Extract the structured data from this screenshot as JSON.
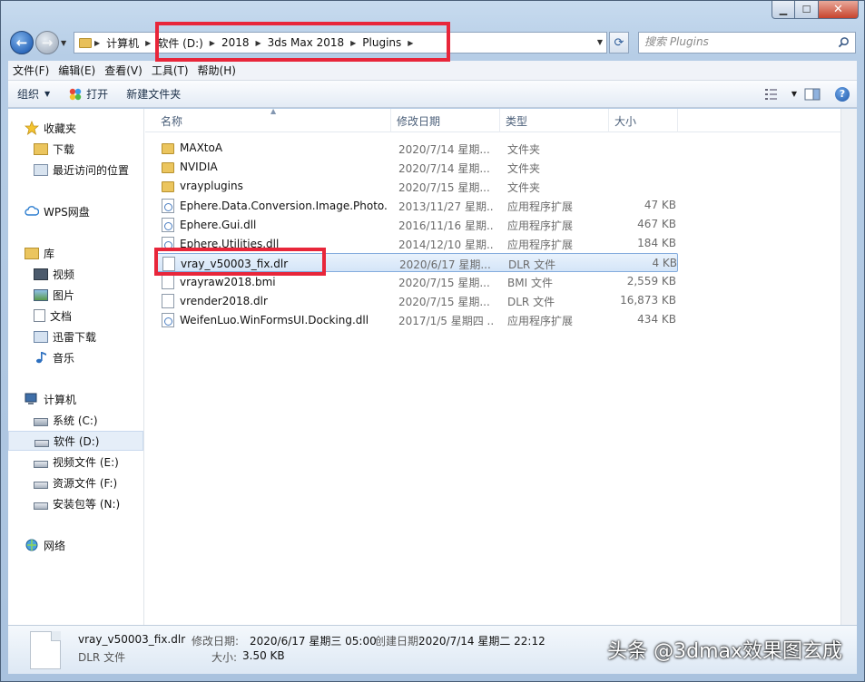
{
  "address": {
    "crumbs": [
      "计算机",
      "软件 (D:)",
      "2018",
      "3ds Max 2018",
      "Plugins"
    ]
  },
  "search": {
    "placeholder": "搜索 Plugins"
  },
  "menu": [
    "文件(F)",
    "编辑(E)",
    "查看(V)",
    "工具(T)",
    "帮助(H)"
  ],
  "toolbar": {
    "organize": "组织",
    "open": "打开",
    "new_folder": "新建文件夹"
  },
  "sidebar": {
    "favorites": "收藏夹",
    "downloads": "下载",
    "recent": "最近访问的位置",
    "wps": "WPS网盘",
    "library": "库",
    "videos": "视频",
    "pictures": "图片",
    "documents": "文档",
    "thunder": "迅雷下载",
    "music": "音乐",
    "computer": "计算机",
    "drive_c": "系统 (C:)",
    "drive_d": "软件 (D:)",
    "drive_e": "视频文件 (E:)",
    "drive_f": "资源文件 (F:)",
    "drive_n": "安装包等 (N:)",
    "network": "网络"
  },
  "columns": {
    "name": "名称",
    "date": "修改日期",
    "type": "类型",
    "size": "大小"
  },
  "files": [
    {
      "icon": "folder",
      "name": "MAXtoA",
      "date": "2020/7/14 星期...",
      "type": "文件夹",
      "size": ""
    },
    {
      "icon": "folder",
      "name": "NVIDIA",
      "date": "2020/7/14 星期...",
      "type": "文件夹",
      "size": ""
    },
    {
      "icon": "folder",
      "name": "vrayplugins",
      "date": "2020/7/15 星期...",
      "type": "文件夹",
      "size": ""
    },
    {
      "icon": "dll",
      "name": "Ephere.Data.Conversion.Image.Photo...",
      "date": "2013/11/27 星期...",
      "type": "应用程序扩展",
      "size": "47 KB"
    },
    {
      "icon": "dll",
      "name": "Ephere.Gui.dll",
      "date": "2016/11/16 星期...",
      "type": "应用程序扩展",
      "size": "467 KB"
    },
    {
      "icon": "dll",
      "name": "Ephere.Utilities.dll",
      "date": "2014/12/10 星期...",
      "type": "应用程序扩展",
      "size": "184 KB"
    },
    {
      "icon": "file",
      "name": "vray_v50003_fix.dlr",
      "date": "2020/6/17 星期...",
      "type": "DLR 文件",
      "size": "4 KB"
    },
    {
      "icon": "file",
      "name": "vrayraw2018.bmi",
      "date": "2020/7/15 星期...",
      "type": "BMI 文件",
      "size": "2,559 KB"
    },
    {
      "icon": "file",
      "name": "vrender2018.dlr",
      "date": "2020/7/15 星期...",
      "type": "DLR 文件",
      "size": "16,873 KB"
    },
    {
      "icon": "dll",
      "name": "WeifenLuo.WinFormsUI.Docking.dll",
      "date": "2017/1/5 星期四 ...",
      "type": "应用程序扩展",
      "size": "434 KB"
    }
  ],
  "selected_index": 6,
  "details": {
    "name": "vray_v50003_fix.dlr",
    "type": "DLR 文件",
    "modified_label": "修改日期:",
    "modified": "2020/6/17 星期三 05:00",
    "created_label": "创建日期:",
    "created": "2020/7/14 星期二 22:12",
    "size_label": "大小:",
    "size": "3.50 KB"
  },
  "watermark": "头条 @3dmax效果图玄成",
  "colors": {
    "highlight": "#e8263a",
    "selection": "#d4e5f8",
    "folder": "#ebc55e"
  }
}
